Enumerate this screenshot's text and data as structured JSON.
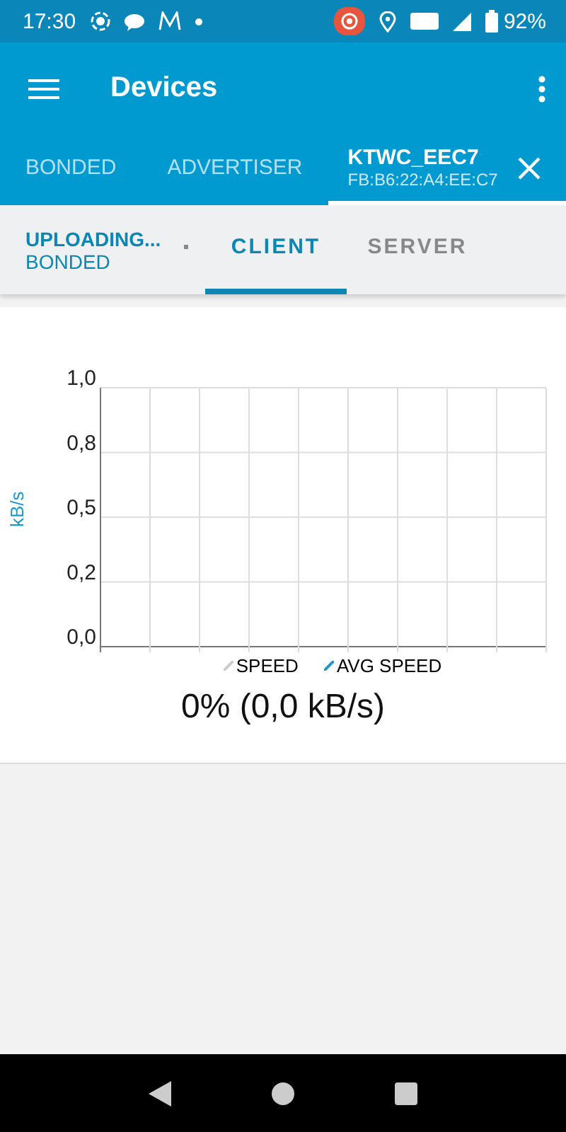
{
  "status_bar": {
    "time": "17:30",
    "battery": "92%"
  },
  "app_bar": {
    "title": "Devices"
  },
  "tabs": [
    {
      "label": "BONDED",
      "selected": false
    },
    {
      "label": "ADVERTISER",
      "selected": false
    },
    {
      "label": "KTWC_EEC7",
      "subtitle": "FB:B6:22:A4:EE:C7",
      "selected": true
    }
  ],
  "device": {
    "status": "UPLOADING...",
    "bond": "BONDED"
  },
  "sub_tabs": [
    {
      "label": "CLIENT",
      "selected": true
    },
    {
      "label": "SERVER",
      "selected": false
    }
  ],
  "chart": {
    "chart_data": {
      "type": "line",
      "grid": true,
      "ylabel": "kB/s",
      "ylim": [
        0,
        1
      ],
      "yticks": [
        {
          "value": 0,
          "label": "0,0"
        },
        {
          "value": 0.25,
          "label": "0,2"
        },
        {
          "value": 0.5,
          "label": "0,5"
        },
        {
          "value": 0.75,
          "label": "0,8"
        },
        {
          "value": 1,
          "label": "1,0"
        }
      ],
      "series": [
        {
          "name": "SPEED",
          "color": "#cccccc"
        },
        {
          "name": "AVG SPEED",
          "color": "#1a9bd0"
        }
      ]
    },
    "progress": "0% (0,0 kB/s)"
  }
}
